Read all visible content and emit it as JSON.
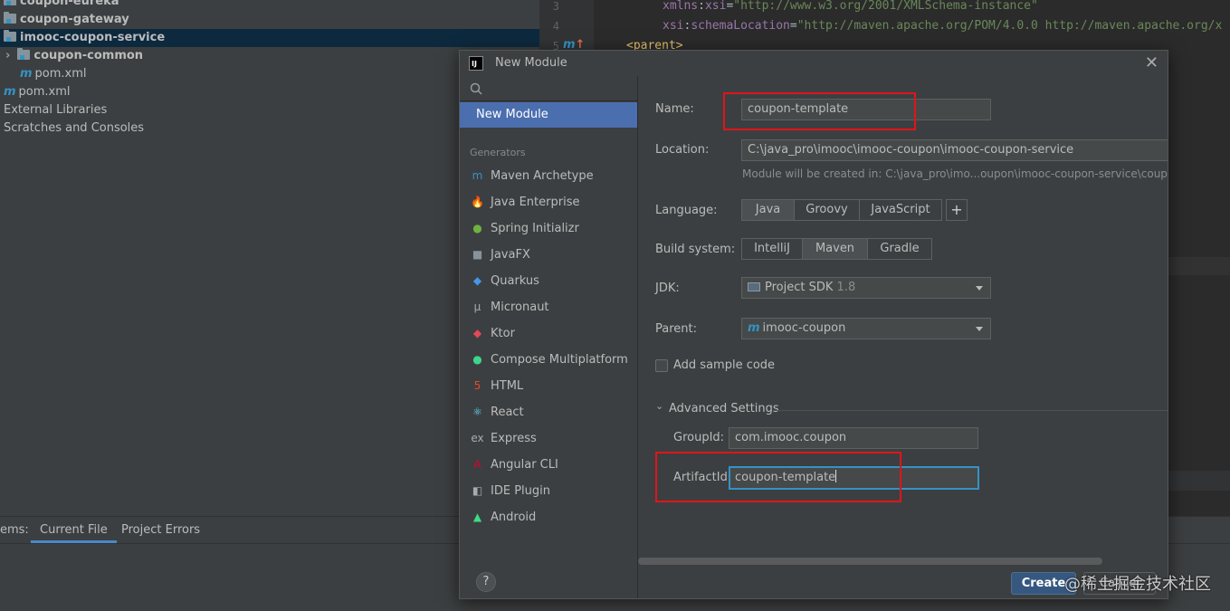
{
  "tree": {
    "items": [
      {
        "label": "coupon-eureka",
        "icon": "module-folder-icon"
      },
      {
        "label": "coupon-gateway",
        "icon": "module-folder-icon"
      },
      {
        "label": "imooc-coupon-service",
        "icon": "module-folder-icon"
      },
      {
        "label": "coupon-common",
        "icon": "module-folder-icon"
      },
      {
        "label": "pom.xml",
        "icon": "maven-icon"
      },
      {
        "label": "pom.xml",
        "icon": "maven-icon"
      },
      {
        "label": "External Libraries",
        "icon": ""
      },
      {
        "label": "Scratches and Consoles",
        "icon": ""
      }
    ]
  },
  "editor": {
    "lines": [
      {
        "num": "3",
        "ns": "xmlns",
        "attr": "xsi",
        "value": "\"http://www.w3.org/2001/XMLSchema-instance\""
      },
      {
        "num": "4",
        "ns": "xsi",
        "attr": "schemaLocation",
        "value": "\"http://maven.apache.org/POM/4.0.0 http://maven.apache.org/x"
      },
      {
        "num": "5",
        "tag": "<parent>"
      }
    ]
  },
  "bottom": {
    "tabs": [
      "ems:",
      "Current File",
      "Project Errors"
    ]
  },
  "dialog": {
    "title": "New Module",
    "close": "✕",
    "left": {
      "selected": "New Module",
      "section": "Generators",
      "generators": [
        {
          "label": "Maven Archetype",
          "icon": "m",
          "color": "#3592c4"
        },
        {
          "label": "Java Enterprise",
          "icon": "🔥",
          "color": "#f0a732"
        },
        {
          "label": "Spring Initializr",
          "icon": "●",
          "color": "#6db33f"
        },
        {
          "label": "JavaFX",
          "icon": "■",
          "color": "#87939a"
        },
        {
          "label": "Quarkus",
          "icon": "◆",
          "color": "#4695eb"
        },
        {
          "label": "Micronaut",
          "icon": "μ",
          "color": "#aaaaaa"
        },
        {
          "label": "Ktor",
          "icon": "◆",
          "color": "#e44857"
        },
        {
          "label": "Compose Multiplatform",
          "icon": "●",
          "color": "#3dd68c"
        },
        {
          "label": "HTML",
          "icon": "5",
          "color": "#e44d26"
        },
        {
          "label": "React",
          "icon": "⚛",
          "color": "#61dafb"
        },
        {
          "label": "Express",
          "icon": "ex",
          "color": "#aaaaaa"
        },
        {
          "label": "Angular CLI",
          "icon": "A",
          "color": "#dd0031"
        },
        {
          "label": "IDE Plugin",
          "icon": "◧",
          "color": "#aaaaaa"
        },
        {
          "label": "Android",
          "icon": "▲",
          "color": "#3ddc84"
        }
      ]
    },
    "form": {
      "name_label": "Name:",
      "name_value": "coupon-template",
      "location_label": "Location:",
      "location_value": "C:\\java_pro\\imooc\\imooc-coupon\\imooc-coupon-service",
      "location_hint": "Module will be created in: C:\\java_pro\\imo...oupon\\imooc-coupon-service\\coupo",
      "language_label": "Language:",
      "languages": [
        "Java",
        "Groovy",
        "JavaScript"
      ],
      "language_selected": "Java",
      "add_language": "+",
      "build_label": "Build system:",
      "build_systems": [
        "IntelliJ",
        "Maven",
        "Gradle"
      ],
      "build_selected": "Maven",
      "jdk_label": "JDK:",
      "jdk_value": "Project SDK",
      "jdk_version": "1.8",
      "parent_label": "Parent:",
      "parent_value": "imooc-coupon",
      "sample_code_label": "Add sample code",
      "advanced_label": "Advanced Settings",
      "groupid_label": "GroupId:",
      "groupid_value": "com.imooc.coupon",
      "artifactid_label": "ArtifactId:",
      "artifactid_value": "coupon-template"
    },
    "footer": {
      "help": "?",
      "create": "Create",
      "cancel": "Cancel"
    }
  },
  "watermark": "@稀土掘金技术社区",
  "colors": {
    "accent": "#4b6eaf",
    "highlight_box": "#e1141a",
    "focus_border": "#3592c4"
  }
}
